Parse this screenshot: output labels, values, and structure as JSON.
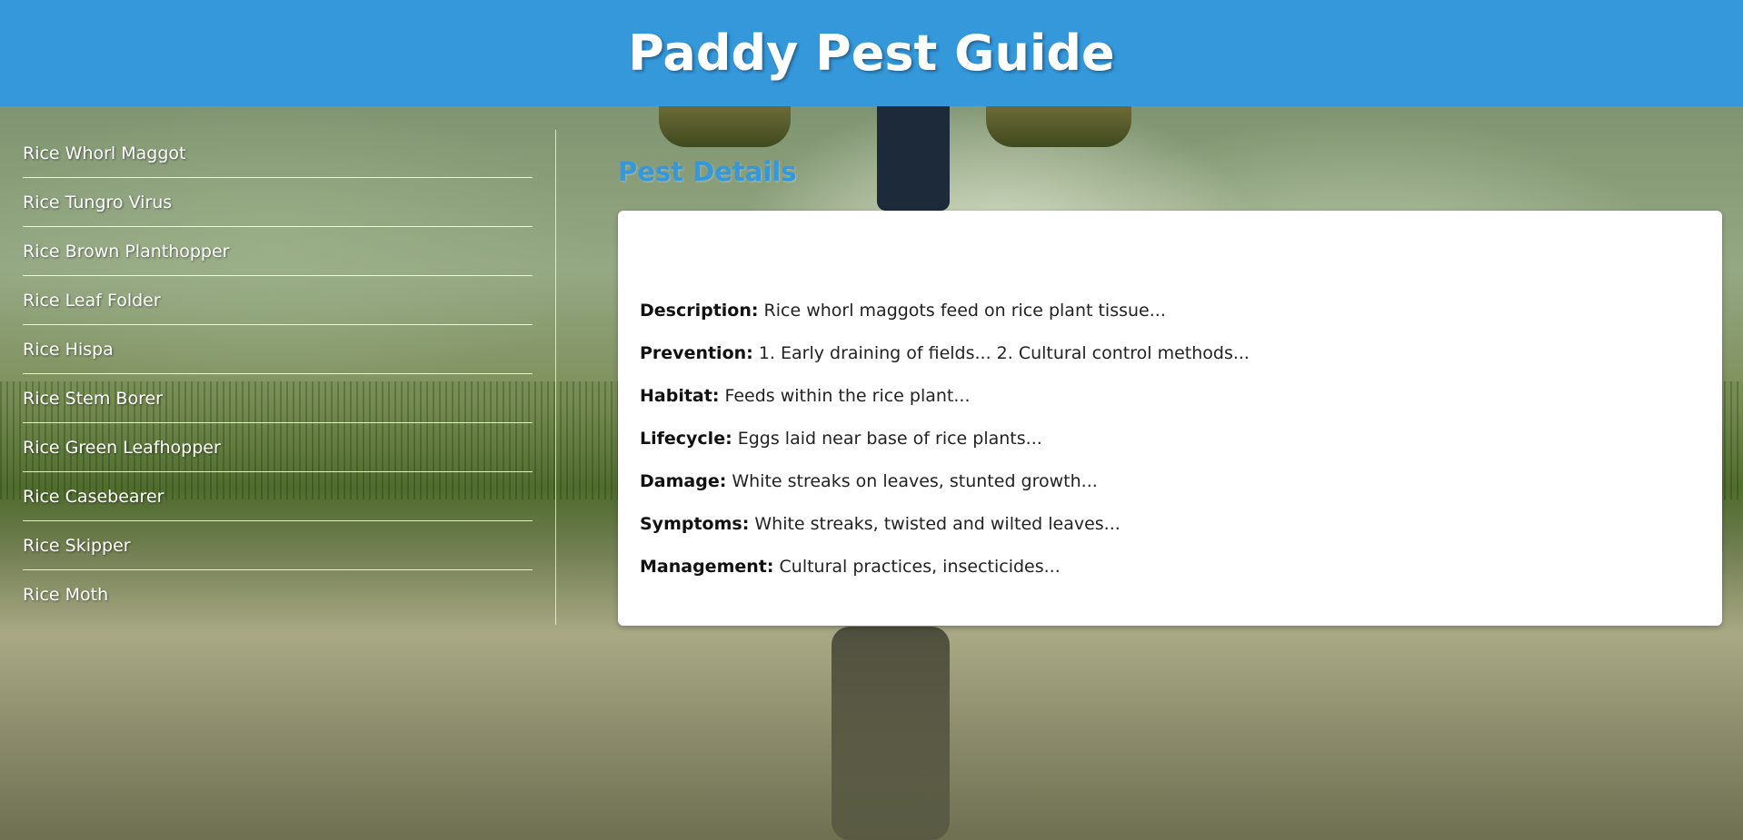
{
  "header": {
    "title": "Paddy Pest Guide"
  },
  "sidebar": {
    "items": [
      {
        "label": "Rice Whorl Maggot"
      },
      {
        "label": "Rice Tungro Virus"
      },
      {
        "label": "Rice Brown Planthopper"
      },
      {
        "label": "Rice Leaf Folder"
      },
      {
        "label": "Rice Hispa"
      },
      {
        "label": "Rice Stem Borer"
      },
      {
        "label": "Rice Green Leafhopper"
      },
      {
        "label": "Rice Casebearer"
      },
      {
        "label": "Rice Skipper"
      },
      {
        "label": "Rice Moth"
      }
    ]
  },
  "main": {
    "title": "Pest Details",
    "details": [
      {
        "label": "Description:",
        "value": "Rice whorl maggots feed on rice plant tissue..."
      },
      {
        "label": "Prevention:",
        "value": "1. Early draining of fields... 2. Cultural control methods..."
      },
      {
        "label": "Habitat:",
        "value": "Feeds within the rice plant..."
      },
      {
        "label": "Lifecycle:",
        "value": "Eggs laid near base of rice plants..."
      },
      {
        "label": "Damage:",
        "value": "White streaks on leaves, stunted growth..."
      },
      {
        "label": "Symptoms:",
        "value": "White streaks, twisted and wilted leaves..."
      },
      {
        "label": "Management:",
        "value": "Cultural practices, insecticides..."
      }
    ]
  },
  "colors": {
    "header_bg": "#3498db",
    "accent": "#3498db",
    "card_bg": "#ffffff"
  }
}
